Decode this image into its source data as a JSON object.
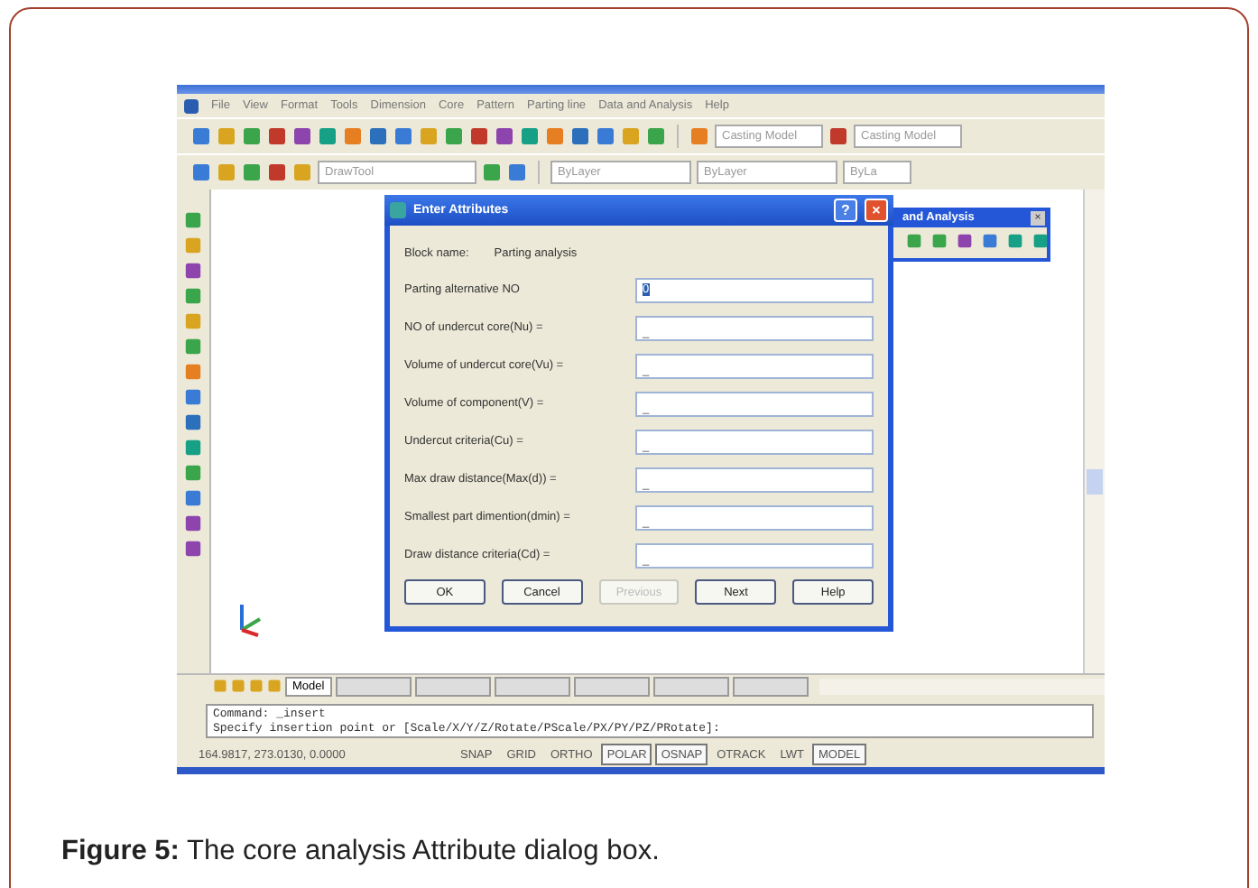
{
  "app": {
    "menu": [
      "File",
      "View",
      "Format",
      "Tools",
      "Dimension",
      "Core",
      "Pattern",
      "Parting line",
      "Data and Analysis",
      "Help"
    ],
    "toolbar_dropdowns": [
      "Casting Model",
      "Casting Model"
    ],
    "properties_dropdowns": [
      "DrawTool",
      "ByLayer",
      "ByLayer",
      "ByLa"
    ],
    "palette": {
      "title": "and Analysis",
      "close": "×"
    },
    "dialog": {
      "title": "Enter Attributes",
      "help": "?",
      "close": "×",
      "block_label": "Block name:",
      "block_name": "Parting analysis",
      "fields": [
        {
          "label": "Parting alternative NO",
          "value": "0",
          "focused": true
        },
        {
          "label": "NO of undercut core(Nu) =",
          "value": "_",
          "focused": false
        },
        {
          "label": "Volume of undercut core(Vu) =",
          "value": "_",
          "focused": false
        },
        {
          "label": "Volume of component(V) =",
          "value": "_",
          "focused": false
        },
        {
          "label": "Undercut criteria(Cu) =",
          "value": "_",
          "focused": false
        },
        {
          "label": "Max draw distance(Max(d)) =",
          "value": "_",
          "focused": false
        },
        {
          "label": "Smallest part dimention(dmin) =",
          "value": "_",
          "focused": false
        },
        {
          "label": "Draw distance criteria(Cd) =",
          "value": "_",
          "focused": false
        }
      ],
      "buttons": [
        {
          "label": "OK",
          "disabled": false
        },
        {
          "label": "Cancel",
          "disabled": false
        },
        {
          "label": "Previous",
          "disabled": true
        },
        {
          "label": "Next",
          "disabled": false
        },
        {
          "label": "Help",
          "disabled": false
        }
      ]
    },
    "tabs": [
      {
        "label": "Model",
        "selected": true
      }
    ],
    "command_lines": [
      "Command:  _insert",
      "Specify insertion point or [Scale/X/Y/Z/Rotate/PScale/PX/PY/PZ/PRotate]:"
    ],
    "status_bar": {
      "coordinates": "164.9817, 273.0130, 0.0000",
      "toggles": [
        {
          "label": "SNAP",
          "on": false
        },
        {
          "label": "GRID",
          "on": false
        },
        {
          "label": "ORTHO",
          "on": false
        },
        {
          "label": "POLAR",
          "on": true
        },
        {
          "label": "OSNAP",
          "on": true
        },
        {
          "label": "OTRACK",
          "on": false
        },
        {
          "label": "LWT",
          "on": false
        },
        {
          "label": "MODEL",
          "on": true
        }
      ]
    }
  },
  "caption": "**Figure 5:** The core analysis Attribute dialog box."
}
